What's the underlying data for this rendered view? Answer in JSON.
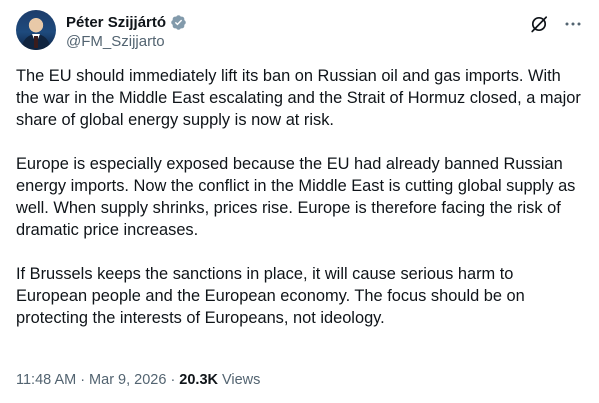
{
  "author": {
    "display_name": "Péter Szijjártó",
    "handle": "@FM_Szijjarto",
    "verified": true,
    "badge_color": "#829aab"
  },
  "icons": {
    "verified": "verified-badge-icon",
    "grok": "grok-icon",
    "more": "more-options-icon"
  },
  "tweet": {
    "paragraphs": [
      "The EU should immediately lift its ban on Russian oil and gas imports. With the war in the Middle East escalating and the Strait of Hormuz closed, a major share of global energy supply is now at risk.",
      "Europe is especially exposed because the EU had already banned Russian energy imports. Now the conflict in the Middle East is cutting global supply as well. When supply shrinks, prices rise. Europe is therefore facing the risk of dramatic price increases.",
      "If Brussels keeps the sanctions in place, it will cause serious harm to European people and the European economy. The focus should be on protecting the interests of Europeans, not ideology."
    ],
    "time": "11:48 AM",
    "date": "Mar 9, 2026",
    "separator": "·",
    "views_count": "20.3K",
    "views_label": "Views"
  }
}
